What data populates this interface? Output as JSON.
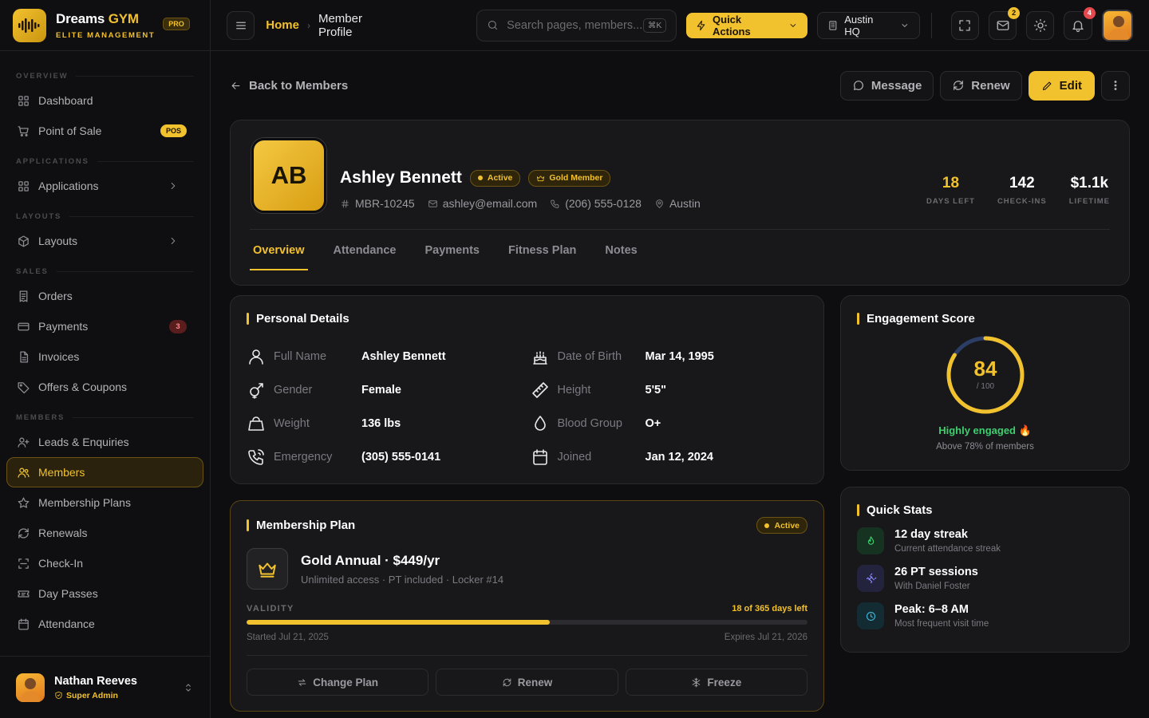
{
  "brand": {
    "name_part1": "Dreams",
    "name_part2": "GYM",
    "tagline": "ELITE MANAGEMENT",
    "badge": "PRO"
  },
  "sidebar": {
    "sections": [
      {
        "title": "OVERVIEW",
        "items": [
          {
            "label": "Dashboard",
            "icon": "grid-icon"
          },
          {
            "label": "Point of Sale",
            "icon": "cart-icon",
            "badge": "POS"
          }
        ]
      },
      {
        "title": "APPLICATIONS",
        "items": [
          {
            "label": "Applications",
            "icon": "grid-icon",
            "chevron": true
          }
        ]
      },
      {
        "title": "LAYOUTS",
        "items": [
          {
            "label": "Layouts",
            "icon": "cube-icon",
            "chevron": true
          }
        ]
      },
      {
        "title": "SALES",
        "items": [
          {
            "label": "Orders",
            "icon": "receipt-icon"
          },
          {
            "label": "Payments",
            "icon": "card-icon",
            "count": "3"
          },
          {
            "label": "Invoices",
            "icon": "document-icon"
          },
          {
            "label": "Offers & Coupons",
            "icon": "tag-icon"
          }
        ]
      },
      {
        "title": "MEMBERS",
        "items": [
          {
            "label": "Leads & Enquiries",
            "icon": "user-plus-icon"
          },
          {
            "label": "Members",
            "icon": "users-icon",
            "active": true
          },
          {
            "label": "Membership Plans",
            "icon": "star-icon"
          },
          {
            "label": "Renewals",
            "icon": "refresh-icon"
          },
          {
            "label": "Check-In",
            "icon": "scan-icon"
          },
          {
            "label": "Day Passes",
            "icon": "ticket-icon"
          },
          {
            "label": "Attendance",
            "icon": "calendar-icon"
          }
        ]
      }
    ],
    "user": {
      "name": "Nathan Reeves",
      "role": "Super Admin"
    }
  },
  "topbar": {
    "breadcrumb_home": "Home",
    "breadcrumb_current": "Member Profile",
    "search_placeholder": "Search pages, members...",
    "search_shortcut": "⌘K",
    "quick_actions": "Quick Actions",
    "location": "Austin HQ",
    "mail_count": "2",
    "notification_count": "4"
  },
  "actions": {
    "back": "Back to Members",
    "message": "Message",
    "renew": "Renew",
    "edit": "Edit"
  },
  "profile": {
    "initials": "AB",
    "name": "Ashley Bennett",
    "status": "Active",
    "tier": "Gold Member",
    "member_id": "MBR-10245",
    "email": "ashley@email.com",
    "phone": "(206) 555-0128",
    "location": "Austin",
    "stats": [
      {
        "value": "18",
        "label": "DAYS LEFT",
        "highlight": true
      },
      {
        "value": "142",
        "label": "CHECK-INS"
      },
      {
        "value": "$1.1k",
        "label": "LIFETIME"
      }
    ],
    "tabs": [
      "Overview",
      "Attendance",
      "Payments",
      "Fitness Plan",
      "Notes"
    ],
    "active_tab": "Overview"
  },
  "personal": {
    "title": "Personal Details",
    "left": [
      {
        "icon": "user-icon",
        "label": "Full Name",
        "value": "Ashley Bennett"
      },
      {
        "icon": "gender-icon",
        "label": "Gender",
        "value": "Female"
      },
      {
        "icon": "weight-icon",
        "label": "Weight",
        "value": "136 lbs"
      },
      {
        "icon": "phone-call-icon",
        "label": "Emergency",
        "value": "(305) 555-0141"
      }
    ],
    "right": [
      {
        "icon": "cake-icon",
        "label": "Date of Birth",
        "value": "Mar 14, 1995"
      },
      {
        "icon": "ruler-icon",
        "label": "Height",
        "value": "5'5\""
      },
      {
        "icon": "droplet-icon",
        "label": "Blood Group",
        "value": "O+"
      },
      {
        "icon": "calendar-icon",
        "label": "Joined",
        "value": "Jan 12, 2024"
      }
    ]
  },
  "membership": {
    "title": "Membership Plan",
    "status": "Active",
    "plan_name": "Gold Annual · $449/yr",
    "plan_desc": "Unlimited access · PT included · Locker #14",
    "validity_label": "VALIDITY",
    "days_left_text": "18 of 365 days left",
    "progress_fraction": 0.54,
    "started": "Started Jul 21, 2025",
    "expires": "Expires Jul 21, 2026",
    "buttons": [
      "Change Plan",
      "Renew",
      "Freeze"
    ]
  },
  "engagement": {
    "title": "Engagement Score",
    "score": "84",
    "max": "/ 100",
    "score_fraction": 0.84,
    "label": "Highly engaged 🔥",
    "sub": "Above 78% of members"
  },
  "quick_stats": {
    "title": "Quick Stats",
    "items": [
      {
        "icon": "flame-icon",
        "title": "12 day streak",
        "sub": "Current attendance streak",
        "color": "#3ecf6e",
        "bg": "#163322"
      },
      {
        "icon": "dumbbell-icon",
        "title": "26 PT sessions",
        "sub": "With Daniel Foster",
        "color": "#8b8cff",
        "bg": "#23233d"
      },
      {
        "icon": "clock-icon",
        "title": "Peak: 6–8 AM",
        "sub": "Most frequent visit time",
        "color": "#3fb8d9",
        "bg": "#132c33"
      }
    ]
  },
  "colors": {
    "accent": "#f2c12e",
    "success": "#3ecf6e",
    "danger": "#e5484d",
    "background": "#0e0e10",
    "card": "#18181b"
  }
}
